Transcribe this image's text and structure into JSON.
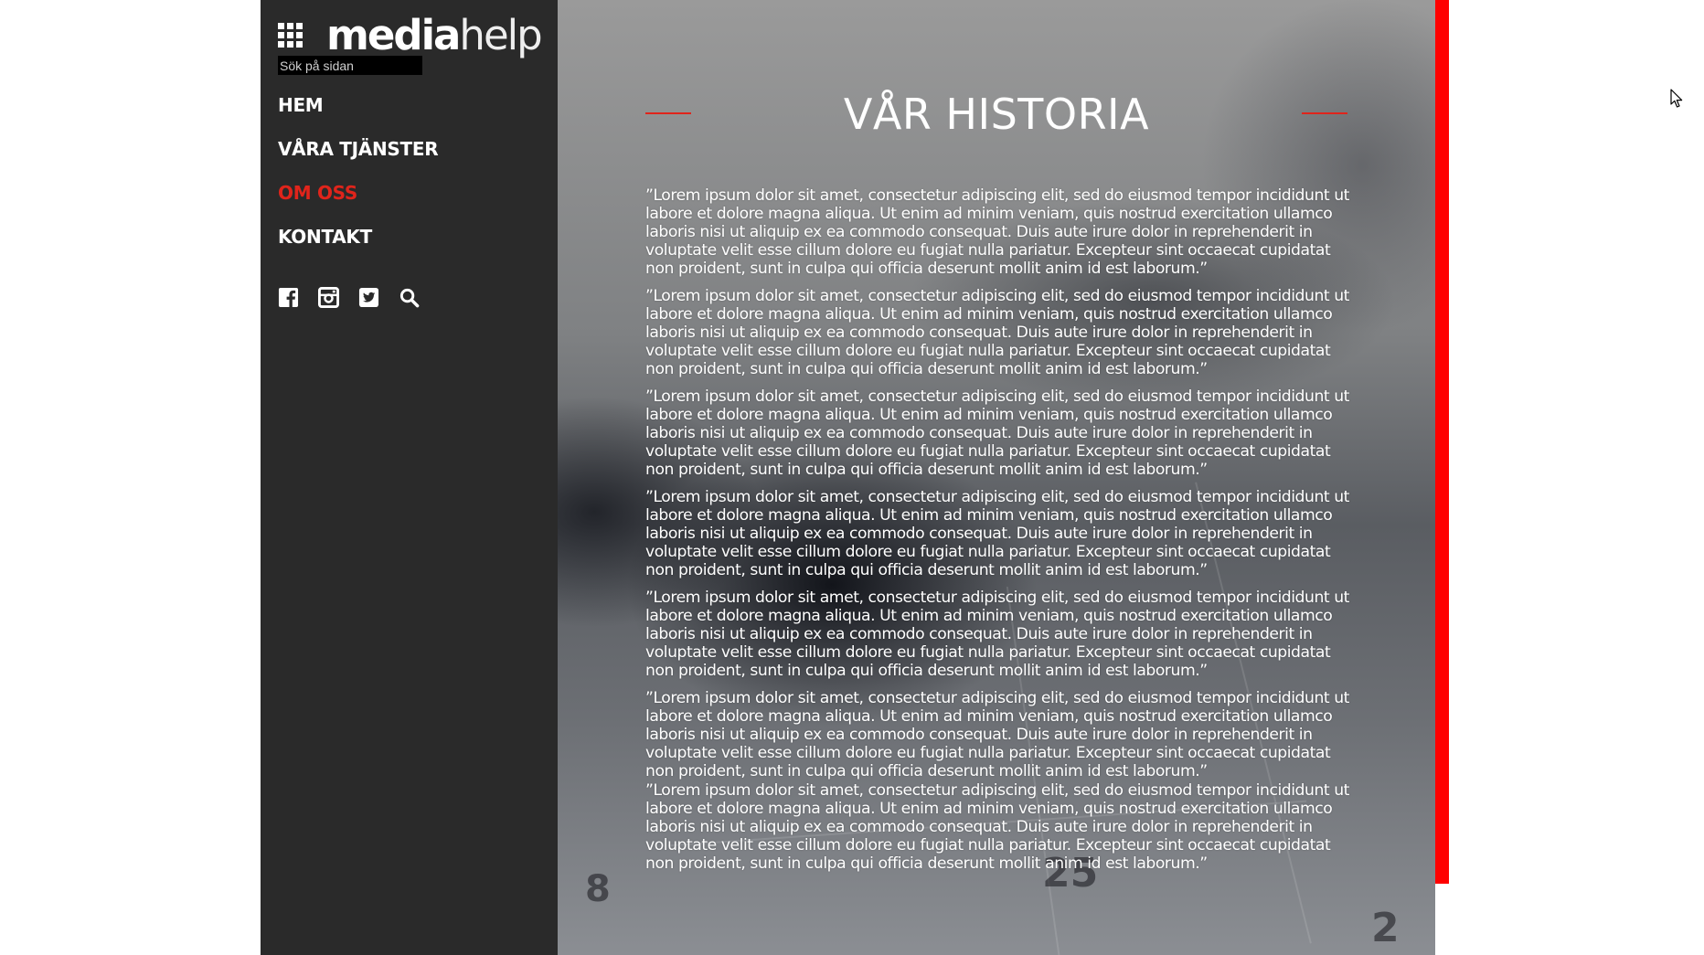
{
  "sidebar": {
    "logo": {
      "bold": "media",
      "light": "help"
    },
    "search": {
      "placeholder": "Sök på sidan"
    },
    "nav": [
      {
        "label": "HEM",
        "active": false
      },
      {
        "label": "VÅRA TJÄNSTER",
        "active": false
      },
      {
        "label": "OM OSS",
        "active": true
      },
      {
        "label": "KONTAKT",
        "active": false
      }
    ],
    "social_icons": [
      "facebook-icon",
      "instagram-icon",
      "twitter-icon",
      "search-icon"
    ]
  },
  "main": {
    "title": "VÅR HISTORIA",
    "paragraphs": [
      "”Lorem ipsum dolor sit amet, consectetur adipiscing elit, sed do eiusmod tempor incididunt ut labore et dolore magna aliqua. Ut enim ad minim veniam, quis nostrud exercitation ullamco laboris nisi ut aliquip ex ea commodo consequat. Duis aute irure dolor in reprehenderit in voluptate velit esse cillum dolore eu fugiat nulla pariatur. Excepteur sint occaecat cupidatat non proident, sunt in culpa qui officia deserunt mollit anim id est laborum.”",
      "”Lorem ipsum dolor sit amet, consectetur adipiscing elit, sed do eiusmod tempor incididunt ut labore et dolore magna aliqua. Ut enim ad minim veniam, quis nostrud exercitation ullamco laboris nisi ut aliquip ex ea commodo consequat. Duis aute irure dolor in reprehenderit in voluptate velit esse cillum dolore eu fugiat nulla pariatur. Excepteur sint occaecat cupidatat non proident, sunt in culpa qui officia deserunt mollit anim id est laborum.”",
      "”Lorem ipsum dolor sit amet, consectetur adipiscing elit, sed do eiusmod tempor incididunt ut labore et dolore magna aliqua. Ut enim ad minim veniam, quis nostrud exercitation ullamco laboris nisi ut aliquip ex ea commodo consequat. Duis aute irure dolor in reprehenderit in voluptate velit esse cillum dolore eu fugiat nulla pariatur. Excepteur sint occaecat cupidatat non proident, sunt in culpa qui officia deserunt mollit anim id est laborum.”",
      "”Lorem ipsum dolor sit amet, consectetur adipiscing elit, sed do eiusmod tempor incididunt ut labore et dolore magna aliqua. Ut enim ad minim veniam, quis nostrud exercitation ullamco laboris nisi ut aliquip ex ea commodo consequat. Duis aute irure dolor in reprehenderit in voluptate velit esse cillum dolore eu fugiat nulla pariatur. Excepteur sint occaecat cupidatat non proident, sunt in culpa qui officia deserunt mollit anim id est laborum.”",
      "”Lorem ipsum dolor sit amet, consectetur adipiscing elit, sed do eiusmod tempor incididunt ut labore et dolore magna aliqua. Ut enim ad minim veniam, quis nostrud exercitation ullamco laboris nisi ut aliquip ex ea commodo consequat. Duis aute irure dolor in reprehenderit in voluptate velit esse cillum dolore eu fugiat nulla pariatur. Excepteur sint occaecat cupidatat non proident, sunt in culpa qui officia deserunt mollit anim id est laborum.”",
      "”Lorem ipsum dolor sit amet, consectetur adipiscing elit, sed do eiusmod tempor incididunt ut labore et dolore magna aliqua. Ut enim ad minim veniam, quis nostrud exercitation ullamco laboris nisi ut aliquip ex ea commodo consequat. Duis aute irure dolor in reprehenderit in voluptate velit esse cillum dolore eu fugiat nulla pariatur. Excepteur sint occaecat cupidatat non proident, sunt in culpa qui officia deserunt mollit anim id est laborum.”",
      "”Lorem ipsum dolor sit amet, consectetur adipiscing elit, sed do eiusmod tempor incididunt ut labore et dolore magna aliqua. Ut enim ad minim veniam, quis nostrud exercitation ullamco laboris nisi ut aliquip ex ea commodo consequat. Duis aute irure dolor in reprehenderit in voluptate velit esse cillum dolore eu fugiat nulla pariatur. Excepteur sint occaecat cupidatat non proident, sunt in culpa qui officia deserunt mollit anim id est laborum.”"
    ]
  },
  "colors": {
    "sidebar_bg": "#2a2a2a",
    "accent_red": "#e0241b",
    "side_bar_red": "#ff0000",
    "text_white": "#ffffff"
  }
}
